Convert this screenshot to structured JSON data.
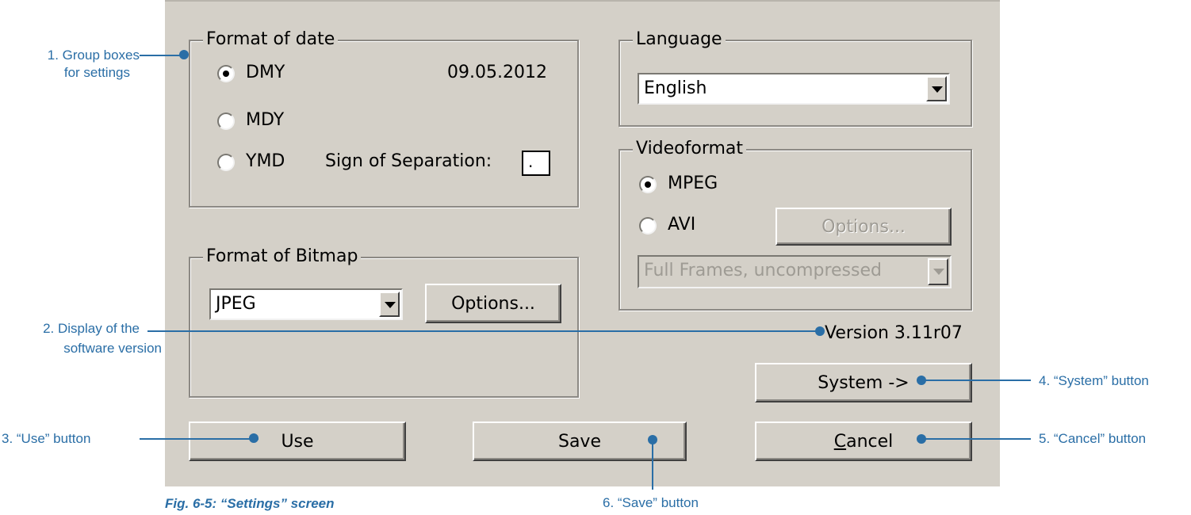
{
  "date_group": {
    "title": "Format of date",
    "options": [
      "DMY",
      "MDY",
      "YMD"
    ],
    "selected": "DMY",
    "date_preview": "09.05.2012",
    "separator_label": "Sign of Separation:",
    "separator_value": "."
  },
  "language_group": {
    "title": "Language",
    "selected": "English"
  },
  "video_group": {
    "title": "Videoformat",
    "options": [
      "MPEG",
      "AVI"
    ],
    "selected": "MPEG",
    "options_button": "Options...",
    "codec_selected": "Full Frames, uncompressed"
  },
  "bitmap_group": {
    "title": "Format of Bitmap",
    "selected": "JPEG",
    "options_button": "Options..."
  },
  "version_text": "Version 3.11r07",
  "buttons": {
    "system": "System ->",
    "use": "Use",
    "save": "Save",
    "cancel_prefix": "C",
    "cancel_rest": "ancel"
  },
  "annotations": {
    "a1_line1": "1. Group boxes",
    "a1_line2": "for settings",
    "a2_line1": "2. Display of the",
    "a2_line2": "software version",
    "a3": "3. “Use” button",
    "a4": "4. “System” button",
    "a5": "5. “Cancel” button",
    "a6": "6. “Save” button"
  },
  "caption": "Fig. 6-5: “Settings” screen",
  "colors": {
    "dialog_bg": "#d4d0c8",
    "annotation": "#2a6ea6"
  }
}
